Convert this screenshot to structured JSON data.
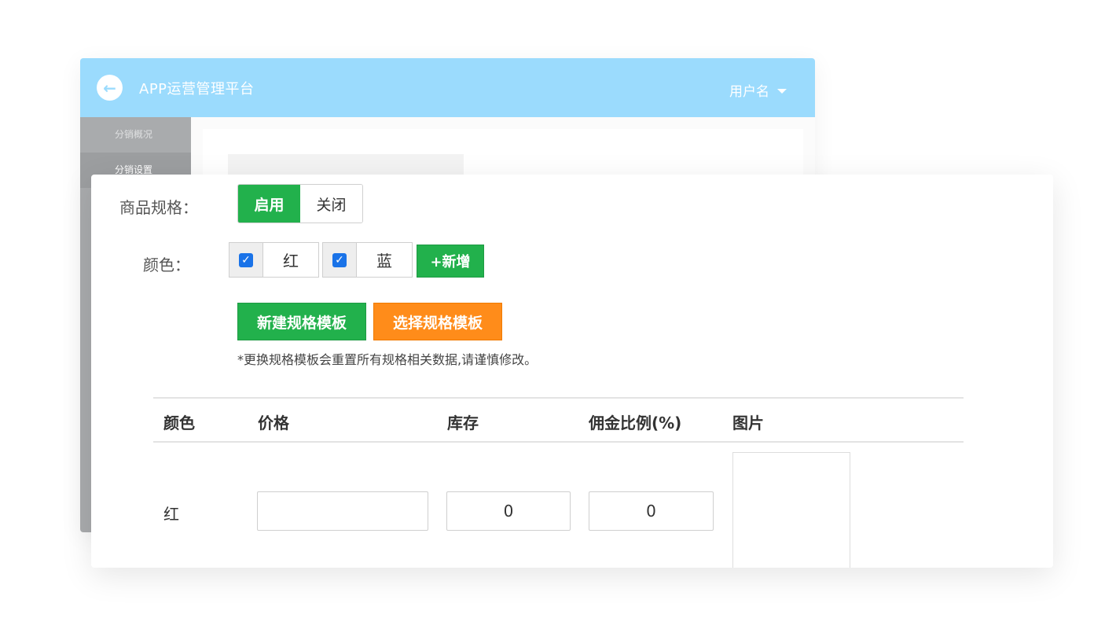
{
  "header": {
    "title": "APP运营管理平台",
    "user": "用户名",
    "back_icon": "arrow-left-icon",
    "caret_icon": "caret-down-icon",
    "bar_color": "#9bdbfd"
  },
  "sidebar": {
    "items": [
      {
        "label": "分销概况"
      },
      {
        "label": "分销设置"
      }
    ]
  },
  "form": {
    "spec_label": "商品规格：",
    "spec_toggle": {
      "on": "启用",
      "off": "关闭",
      "selected": "启用"
    },
    "color_label": "颜色：",
    "colors": [
      {
        "name": "红",
        "checked": true
      },
      {
        "name": "蓝",
        "checked": true
      }
    ],
    "add_label": "+新增",
    "new_template_label": "新建规格模板",
    "select_template_label": "选择规格模板",
    "note": "*更换规格模板会重置所有规格相关数据,请谨慎修改。"
  },
  "table": {
    "headers": [
      "颜色",
      "价格",
      "库存",
      "佣金比例(%)",
      "图片"
    ],
    "rows": [
      {
        "color": "红",
        "price": "",
        "stock": "0",
        "commission": "0"
      }
    ]
  },
  "colors": {
    "green": "#22b14c",
    "orange": "#ff8c1a",
    "sidebar": "#a9abad"
  }
}
